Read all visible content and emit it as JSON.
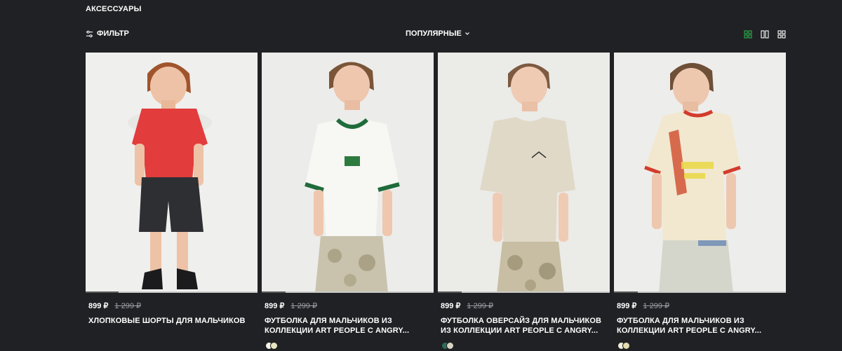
{
  "category": "АКСЕССУАРЫ",
  "toolbar": {
    "filter_label": "ФИЛЬТР",
    "sort_label": "ПОПУЛЯРНЫЕ",
    "views": [
      "grid-4-view-icon",
      "grid-2-view-icon",
      "grid-small-view-icon"
    ],
    "active_color": "#2db34a"
  },
  "products": [
    {
      "price": "899 ₽",
      "old_price": "1 299 ₽",
      "title": "ХЛОПКОВЫЕ ШОРТЫ ДЛЯ МАЛЬЧИКОВ",
      "swatches": [],
      "slide_progress": 0.19
    },
    {
      "price": "899 ₽",
      "old_price": "1 299 ₽",
      "title": "ФУТБОЛКА ДЛЯ МАЛЬЧИКОВ ИЗ КОЛЛЕКЦИИ ART PEOPLE С ANGRY...",
      "swatches": [
        "#f7f4e6",
        "#e8e4c0"
      ],
      "slide_progress": 0.14
    },
    {
      "price": "899 ₽",
      "old_price": "1 299 ₽",
      "title": "ФУТБОЛКА ОВЕРСАЙЗ ДЛЯ МАЛЬЧИКОВ ИЗ КОЛЛЕКЦИИ ART PEOPLE С ANGRY...",
      "swatches": [
        "#2f6b57",
        "#d9d3c3"
      ],
      "slide_progress": 0.14
    },
    {
      "price": "899 ₽",
      "old_price": "1 299 ₽",
      "title": "ФУТБОЛКА ДЛЯ МАЛЬЧИКОВ ИЗ КОЛЛЕКЦИИ ART PEOPLE С ANGRY...",
      "swatches": [
        "#f3eedb",
        "#e3dcae"
      ],
      "slide_progress": 0.14
    }
  ]
}
